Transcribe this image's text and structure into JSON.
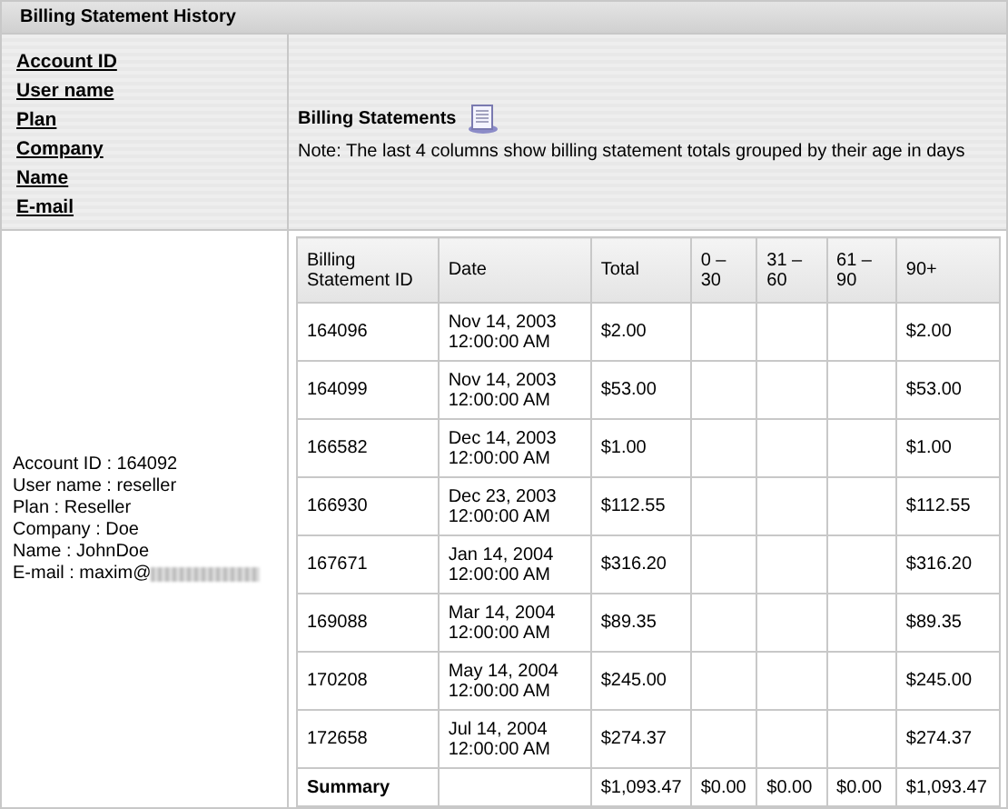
{
  "panel": {
    "title": "Billing Statement History"
  },
  "sort_links": [
    "Account ID",
    "User name",
    "Plan",
    "Company",
    "Name",
    "E-mail"
  ],
  "statements": {
    "title": "Billing Statements",
    "note": "Note: The last 4 columns show billing statement totals grouped by their age in days"
  },
  "account": {
    "lines": [
      "Account ID : 164092",
      "User name : reseller",
      "Plan : Reseller",
      "Company : Doe",
      "Name : JohnDoe"
    ],
    "email_label": "E-mail : maxim@"
  },
  "table": {
    "columns": [
      "Billing Statement ID",
      "Date",
      "Total",
      "0 – 30",
      "31 – 60",
      "61 – 90",
      "90+"
    ],
    "rows": [
      [
        "164096",
        "Nov 14, 2003 12:00:00 AM",
        "$2.00",
        "",
        "",
        "",
        "$2.00"
      ],
      [
        "164099",
        "Nov 14, 2003 12:00:00 AM",
        "$53.00",
        "",
        "",
        "",
        "$53.00"
      ],
      [
        "166582",
        "Dec 14, 2003 12:00:00 AM",
        "$1.00",
        "",
        "",
        "",
        "$1.00"
      ],
      [
        "166930",
        "Dec 23, 2003 12:00:00 AM",
        "$112.55",
        "",
        "",
        "",
        "$112.55"
      ],
      [
        "167671",
        "Jan 14, 2004 12:00:00 AM",
        "$316.20",
        "",
        "",
        "",
        "$316.20"
      ],
      [
        "169088",
        "Mar 14, 2004 12:00:00 AM",
        "$89.35",
        "",
        "",
        "",
        "$89.35"
      ],
      [
        "170208",
        "May 14, 2004 12:00:00 AM",
        "$245.00",
        "",
        "",
        "",
        "$245.00"
      ],
      [
        "172658",
        "Jul 14, 2004 12:00:00 AM",
        "$274.37",
        "",
        "",
        "",
        "$274.37"
      ]
    ],
    "summary": {
      "label": "Summary",
      "values": [
        "$1,093.47",
        "$0.00",
        "$0.00",
        "$0.00",
        "$1,093.47"
      ]
    }
  }
}
